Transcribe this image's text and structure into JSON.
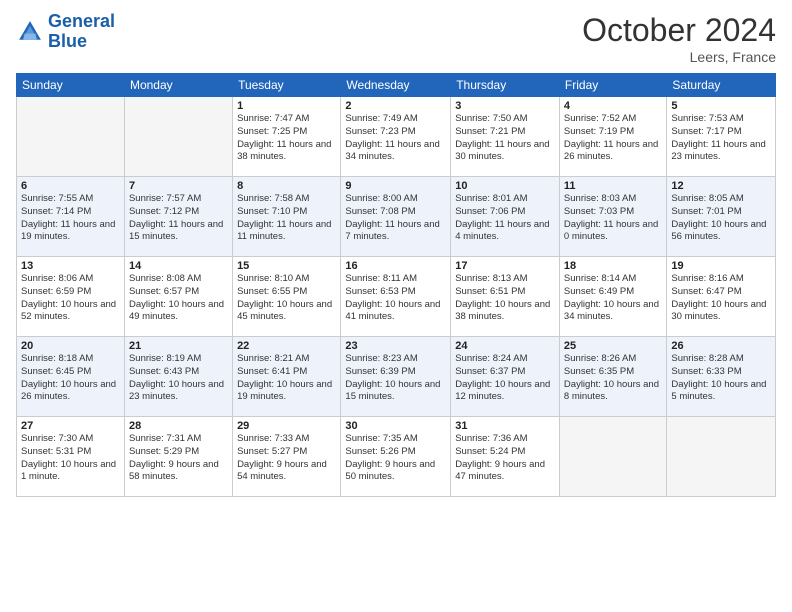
{
  "logo": {
    "line1": "General",
    "line2": "Blue"
  },
  "title": "October 2024",
  "location": "Leers, France",
  "days_of_week": [
    "Sunday",
    "Monday",
    "Tuesday",
    "Wednesday",
    "Thursday",
    "Friday",
    "Saturday"
  ],
  "weeks": [
    [
      {
        "day": "",
        "empty": true
      },
      {
        "day": "",
        "empty": true
      },
      {
        "day": "1",
        "sunrise": "7:47 AM",
        "sunset": "7:25 PM",
        "daylight": "11 hours and 38 minutes."
      },
      {
        "day": "2",
        "sunrise": "7:49 AM",
        "sunset": "7:23 PM",
        "daylight": "11 hours and 34 minutes."
      },
      {
        "day": "3",
        "sunrise": "7:50 AM",
        "sunset": "7:21 PM",
        "daylight": "11 hours and 30 minutes."
      },
      {
        "day": "4",
        "sunrise": "7:52 AM",
        "sunset": "7:19 PM",
        "daylight": "11 hours and 26 minutes."
      },
      {
        "day": "5",
        "sunrise": "7:53 AM",
        "sunset": "7:17 PM",
        "daylight": "11 hours and 23 minutes."
      }
    ],
    [
      {
        "day": "6",
        "sunrise": "7:55 AM",
        "sunset": "7:14 PM",
        "daylight": "11 hours and 19 minutes."
      },
      {
        "day": "7",
        "sunrise": "7:57 AM",
        "sunset": "7:12 PM",
        "daylight": "11 hours and 15 minutes."
      },
      {
        "day": "8",
        "sunrise": "7:58 AM",
        "sunset": "7:10 PM",
        "daylight": "11 hours and 11 minutes."
      },
      {
        "day": "9",
        "sunrise": "8:00 AM",
        "sunset": "7:08 PM",
        "daylight": "11 hours and 7 minutes."
      },
      {
        "day": "10",
        "sunrise": "8:01 AM",
        "sunset": "7:06 PM",
        "daylight": "11 hours and 4 minutes."
      },
      {
        "day": "11",
        "sunrise": "8:03 AM",
        "sunset": "7:03 PM",
        "daylight": "11 hours and 0 minutes."
      },
      {
        "day": "12",
        "sunrise": "8:05 AM",
        "sunset": "7:01 PM",
        "daylight": "10 hours and 56 minutes."
      }
    ],
    [
      {
        "day": "13",
        "sunrise": "8:06 AM",
        "sunset": "6:59 PM",
        "daylight": "10 hours and 52 minutes."
      },
      {
        "day": "14",
        "sunrise": "8:08 AM",
        "sunset": "6:57 PM",
        "daylight": "10 hours and 49 minutes."
      },
      {
        "day": "15",
        "sunrise": "8:10 AM",
        "sunset": "6:55 PM",
        "daylight": "10 hours and 45 minutes."
      },
      {
        "day": "16",
        "sunrise": "8:11 AM",
        "sunset": "6:53 PM",
        "daylight": "10 hours and 41 minutes."
      },
      {
        "day": "17",
        "sunrise": "8:13 AM",
        "sunset": "6:51 PM",
        "daylight": "10 hours and 38 minutes."
      },
      {
        "day": "18",
        "sunrise": "8:14 AM",
        "sunset": "6:49 PM",
        "daylight": "10 hours and 34 minutes."
      },
      {
        "day": "19",
        "sunrise": "8:16 AM",
        "sunset": "6:47 PM",
        "daylight": "10 hours and 30 minutes."
      }
    ],
    [
      {
        "day": "20",
        "sunrise": "8:18 AM",
        "sunset": "6:45 PM",
        "daylight": "10 hours and 26 minutes."
      },
      {
        "day": "21",
        "sunrise": "8:19 AM",
        "sunset": "6:43 PM",
        "daylight": "10 hours and 23 minutes."
      },
      {
        "day": "22",
        "sunrise": "8:21 AM",
        "sunset": "6:41 PM",
        "daylight": "10 hours and 19 minutes."
      },
      {
        "day": "23",
        "sunrise": "8:23 AM",
        "sunset": "6:39 PM",
        "daylight": "10 hours and 15 minutes."
      },
      {
        "day": "24",
        "sunrise": "8:24 AM",
        "sunset": "6:37 PM",
        "daylight": "10 hours and 12 minutes."
      },
      {
        "day": "25",
        "sunrise": "8:26 AM",
        "sunset": "6:35 PM",
        "daylight": "10 hours and 8 minutes."
      },
      {
        "day": "26",
        "sunrise": "8:28 AM",
        "sunset": "6:33 PM",
        "daylight": "10 hours and 5 minutes."
      }
    ],
    [
      {
        "day": "27",
        "sunrise": "7:30 AM",
        "sunset": "5:31 PM",
        "daylight": "10 hours and 1 minute."
      },
      {
        "day": "28",
        "sunrise": "7:31 AM",
        "sunset": "5:29 PM",
        "daylight": "9 hours and 58 minutes."
      },
      {
        "day": "29",
        "sunrise": "7:33 AM",
        "sunset": "5:27 PM",
        "daylight": "9 hours and 54 minutes."
      },
      {
        "day": "30",
        "sunrise": "7:35 AM",
        "sunset": "5:26 PM",
        "daylight": "9 hours and 50 minutes."
      },
      {
        "day": "31",
        "sunrise": "7:36 AM",
        "sunset": "5:24 PM",
        "daylight": "9 hours and 47 minutes."
      },
      {
        "day": "",
        "empty": true
      },
      {
        "day": "",
        "empty": true
      }
    ]
  ]
}
